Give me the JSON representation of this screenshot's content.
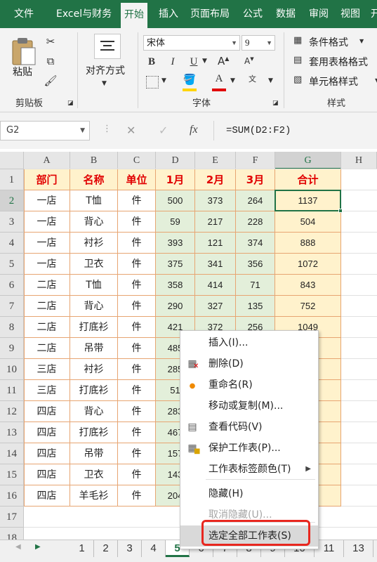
{
  "ribbon_tabs": [
    "文件",
    "Excel与财务",
    "开始",
    "插入",
    "页面布局",
    "公式",
    "数据",
    "审阅",
    "视图",
    "开"
  ],
  "active_tab": "开始",
  "clipboard": {
    "paste_label": "粘贴",
    "group_label": "剪贴板"
  },
  "alignment": {
    "label": "对齐方式"
  },
  "font": {
    "name": "宋体",
    "size": "9",
    "group_label": "字体",
    "bold": "B",
    "italic": "I",
    "underline": "U",
    "color_accent": "#e10000",
    "fill_accent": "#ffd400"
  },
  "styles": {
    "conditional": "条件格式",
    "table_format": "套用表格格式",
    "cell_style": "单元格样式",
    "group_label": "样式"
  },
  "formula_bar": {
    "name_box": "G2",
    "fx": "fx",
    "formula": "=SUM(D2:F2)"
  },
  "columns": [
    "A",
    "B",
    "C",
    "D",
    "E",
    "F",
    "G",
    "H"
  ],
  "rows": [
    "1",
    "2",
    "3",
    "4",
    "5",
    "6",
    "7",
    "8",
    "9",
    "10",
    "11",
    "12",
    "13",
    "14",
    "15",
    "16",
    "17",
    "18"
  ],
  "table": {
    "headers": [
      "部门",
      "名称",
      "单位",
      "1月",
      "2月",
      "3月",
      "合计"
    ],
    "data": [
      [
        "一店",
        "T恤",
        "件",
        "500",
        "373",
        "264",
        "1137"
      ],
      [
        "一店",
        "背心",
        "件",
        "59",
        "217",
        "228",
        "504"
      ],
      [
        "一店",
        "衬衫",
        "件",
        "393",
        "121",
        "374",
        "888"
      ],
      [
        "一店",
        "卫衣",
        "件",
        "375",
        "341",
        "356",
        "1072"
      ],
      [
        "二店",
        "T恤",
        "件",
        "358",
        "414",
        "71",
        "843"
      ],
      [
        "二店",
        "背心",
        "件",
        "290",
        "327",
        "135",
        "752"
      ],
      [
        "二店",
        "打底衫",
        "件",
        "421",
        "372",
        "256",
        "1049"
      ],
      [
        "二店",
        "吊带",
        "件",
        "485",
        "",
        "",
        ""
      ],
      [
        "三店",
        "衬衫",
        "件",
        "285",
        "",
        "",
        ""
      ],
      [
        "三店",
        "打底衫",
        "件",
        "51",
        "",
        "",
        ""
      ],
      [
        "四店",
        "背心",
        "件",
        "283",
        "",
        "",
        ""
      ],
      [
        "四店",
        "打底衫",
        "件",
        "467",
        "",
        "",
        ""
      ],
      [
        "四店",
        "吊带",
        "件",
        "157",
        "",
        "",
        ""
      ],
      [
        "四店",
        "卫衣",
        "件",
        "143",
        "",
        "",
        ""
      ],
      [
        "四店",
        "羊毛衫",
        "件",
        "204",
        "",
        "",
        ""
      ]
    ]
  },
  "sheet_tabs": [
    "1",
    "2",
    "3",
    "4",
    "5",
    "6",
    "7",
    "8",
    "9",
    "10",
    "11",
    "13"
  ],
  "active_sheet": "5",
  "context_menu": [
    {
      "label": "插入(I)...",
      "icon": "",
      "disabled": false
    },
    {
      "label": "删除(D)",
      "icon": "delete-sheet-icon",
      "disabled": false
    },
    {
      "label": "重命名(R)",
      "icon": "rename-icon",
      "disabled": false
    },
    {
      "label": "移动或复制(M)...",
      "icon": "",
      "disabled": false
    },
    {
      "label": "查看代码(V)",
      "icon": "view-code-icon",
      "disabled": false
    },
    {
      "label": "保护工作表(P)...",
      "icon": "protect-sheet-icon",
      "disabled": false
    },
    {
      "label": "工作表标签颜色(T)",
      "icon": "",
      "disabled": false,
      "submenu": true
    },
    {
      "label": "隐藏(H)",
      "icon": "",
      "disabled": false
    },
    {
      "label": "取消隐藏(U)...",
      "icon": "",
      "disabled": true
    },
    {
      "label": "选定全部工作表(S)",
      "icon": "",
      "disabled": false,
      "highlighted": true
    }
  ],
  "colors": {
    "brand": "#217346",
    "header_text": "#e10000",
    "cell_border": "#e7a572",
    "month_fill": "#e3efda",
    "total_fill": "#fff2cc",
    "callout": "#e8271f"
  }
}
